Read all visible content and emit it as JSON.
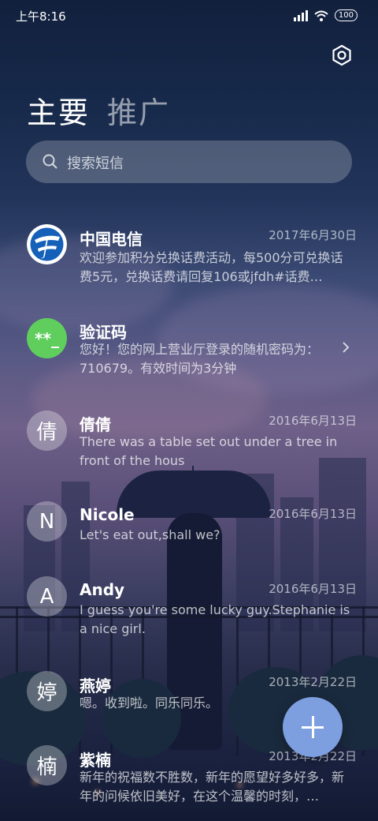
{
  "status_bar": {
    "time": "上午8:16",
    "battery": "100"
  },
  "tabs": [
    {
      "label": "主要",
      "active": true
    },
    {
      "label": "推广",
      "active": false
    }
  ],
  "search": {
    "placeholder": "搜索短信"
  },
  "conversations": [
    {
      "name": "中国电信",
      "date": "2017年6月30日",
      "preview": "欢迎参加积分兑换话费活动，每500分可兑换话费5元，兑换话费请回复106或jfdh#话费…",
      "avatar": "telecom-logo"
    },
    {
      "name": "验证码",
      "date": "",
      "preview": "您好！您的网上营业厅登录的随机密码为：710679。有效时间为3分钟",
      "avatar": "**_",
      "avatar_color": "#5fce5d"
    },
    {
      "name": "倩倩",
      "date": "2016年6月13日",
      "preview": "There was a table set out under a tree in front of the hous",
      "avatar": "倩"
    },
    {
      "name": "Nicole",
      "date": "2016年6月13日",
      "preview": "Let's eat out,shall we?",
      "avatar": "N"
    },
    {
      "name": "Andy",
      "date": "2016年6月13日",
      "preview": "I guess you're some lucky guy.Stephanie is a nice girl.",
      "avatar": "A"
    },
    {
      "name": "燕婷",
      "date": "2013年2月22日",
      "preview": "嗯。收到啦。同乐同乐。",
      "avatar": "婷"
    },
    {
      "name": "紫楠",
      "date": "2013年2月22日",
      "preview": "新年的祝福数不胜数，新年的愿望好多好多，新年的问候依旧美好，在这个温馨的时刻，…",
      "avatar": "楠"
    }
  ],
  "colors": {
    "fab": "#7d9fe0",
    "verify_avatar": "#5fce5d",
    "telecom_blue": "#1560b8"
  }
}
